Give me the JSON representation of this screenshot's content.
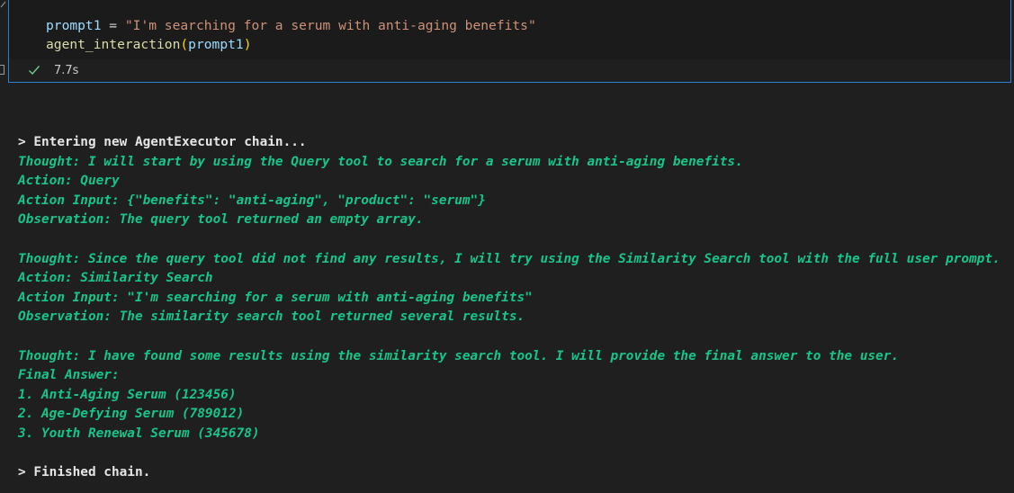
{
  "cell": {
    "code_lines": [
      {
        "var": "prompt1",
        "op": " = ",
        "str": "\"I'm searching for a serum with anti-aging benefits\""
      },
      {
        "fn": "agent_interaction",
        "open": "(",
        "arg": "prompt1",
        "close": ")"
      }
    ],
    "status": {
      "icon": "check-icon",
      "duration": "7.7s",
      "color": "#73c991"
    }
  },
  "output": {
    "lines": [
      {
        "text": "> Entering new AgentExecutor chain...",
        "style": "white"
      },
      {
        "text": "Thought: I will start by using the Query tool to search for a serum with anti-aging benefits.",
        "style": "green"
      },
      {
        "text": "Action: Query",
        "style": "green"
      },
      {
        "text": "Action Input: {\"benefits\": \"anti-aging\", \"product\": \"serum\"}",
        "style": "green"
      },
      {
        "text": "Observation: The query tool returned an empty array.",
        "style": "green"
      },
      {
        "text": "",
        "style": "green"
      },
      {
        "text": "Thought: Since the query tool did not find any results, I will try using the Similarity Search tool with the full user prompt.",
        "style": "green"
      },
      {
        "text": "Action: Similarity Search",
        "style": "green"
      },
      {
        "text": "Action Input: \"I'm searching for a serum with anti-aging benefits\"",
        "style": "green"
      },
      {
        "text": "Observation: The similarity search tool returned several results.",
        "style": "green"
      },
      {
        "text": "",
        "style": "green"
      },
      {
        "text": "Thought: I have found some results using the similarity search tool. I will provide the final answer to the user.",
        "style": "green"
      },
      {
        "text": "Final Answer:",
        "style": "green"
      },
      {
        "text": "1. Anti-Aging Serum (123456)",
        "style": "green"
      },
      {
        "text": "2. Age-Defying Serum (789012)",
        "style": "green"
      },
      {
        "text": "3. Youth Renewal Serum (345678)",
        "style": "green"
      },
      {
        "text": "",
        "style": "green"
      },
      {
        "text": "> Finished chain.",
        "style": "white"
      }
    ],
    "colors": {
      "green": "#17c58a",
      "white": "#e6e6e6"
    }
  }
}
